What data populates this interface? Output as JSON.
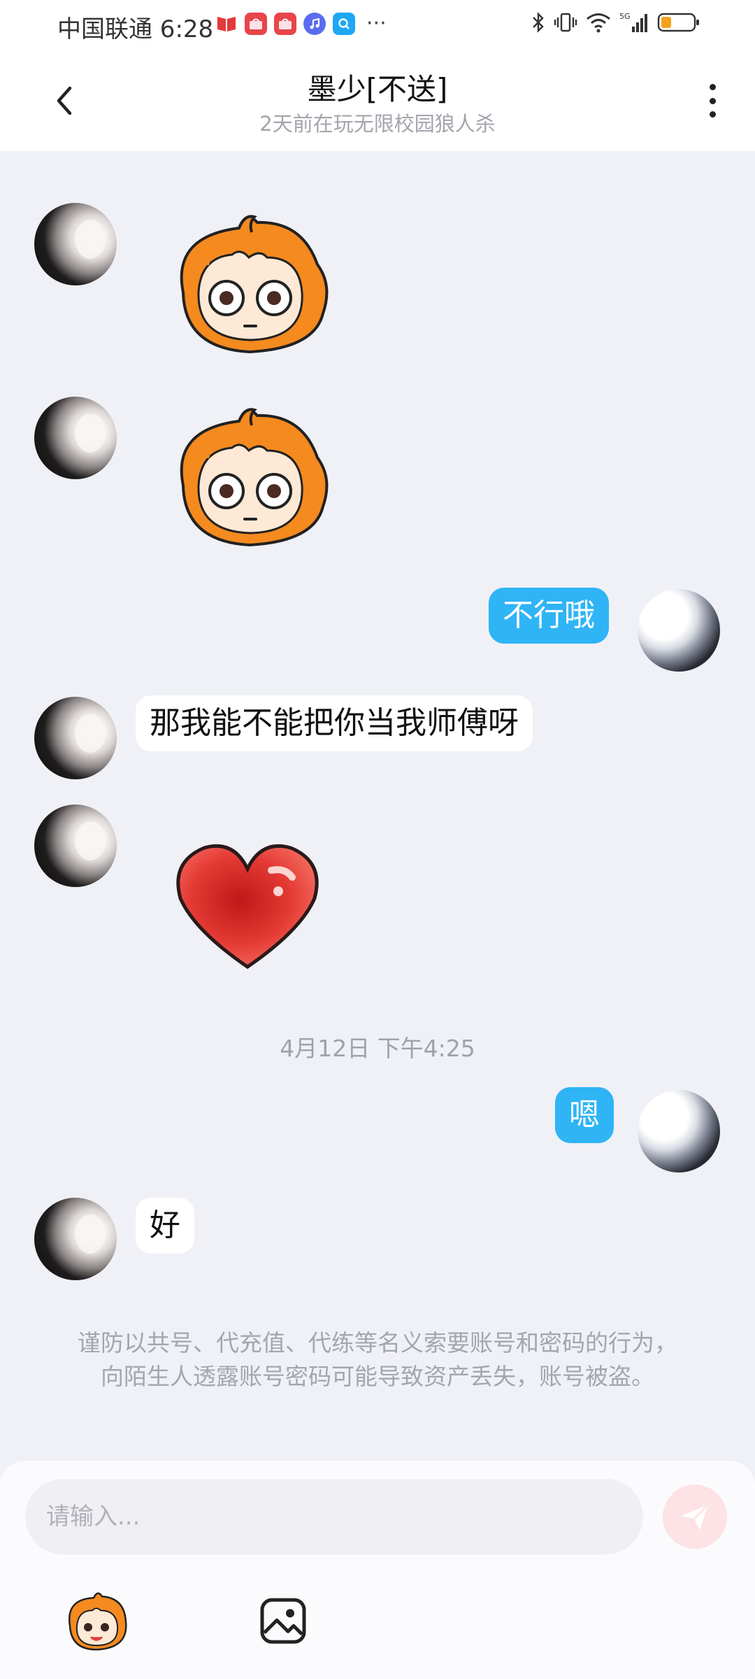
{
  "status_bar": {
    "carrier_time": "中国联通 6:28",
    "more": "···"
  },
  "header": {
    "title": "墨少[不送]",
    "subtitle": "2天前在玩无限校园狼人杀"
  },
  "messages": {
    "m1_text": "不行哦",
    "m2_text": "那我能不能把你当我师傅呀",
    "timestamp": "4月12日 下午4:25",
    "m3_text": "嗯",
    "m4_text": "好"
  },
  "notice": "谨防以共号、代充值、代练等名义索要账号和密码的行为，向陌生人透露账号密码可能导致资产丢失，账号被盗。",
  "composer": {
    "placeholder": "请输入..."
  },
  "colors": {
    "outgoing_bubble": "#2fb4f6",
    "incoming_bubble": "#ffffff",
    "chat_background": "#f0f1f6",
    "send_button_inactive": "#fde3e5"
  }
}
